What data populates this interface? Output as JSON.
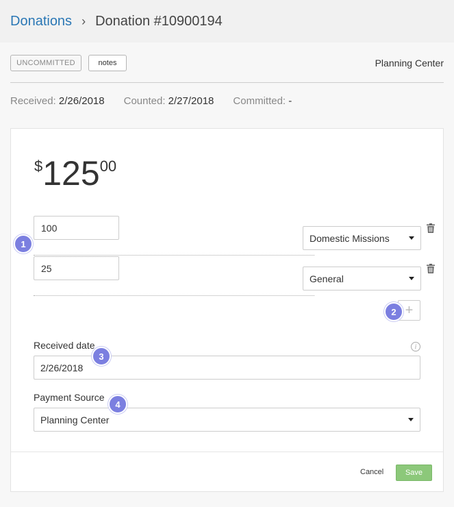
{
  "breadcrumb": {
    "parent": "Donations",
    "separator": "›",
    "current": "Donation #10900194"
  },
  "status": {
    "badge": "UNCOMMITTED",
    "notes_label": "notes",
    "source": "Planning Center"
  },
  "dates": {
    "received_label": "Received:",
    "received_value": "2/26/2018",
    "counted_label": "Counted:",
    "counted_value": "2/27/2018",
    "committed_label": "Committed:",
    "committed_value": "-"
  },
  "amount": {
    "currency": "$",
    "whole": "125",
    "cents": "00"
  },
  "designations": [
    {
      "amount": "100",
      "fund": "Domestic Missions"
    },
    {
      "amount": "25",
      "fund": "General"
    }
  ],
  "add_designation_icon": "plus-icon",
  "received_date": {
    "label": "Received date",
    "value": "2/26/2018"
  },
  "payment_source": {
    "label": "Payment Source",
    "value": "Planning Center"
  },
  "actions": {
    "cancel": "Cancel",
    "save": "Save"
  },
  "markers": [
    "1",
    "2",
    "3",
    "4"
  ],
  "colors": {
    "link": "#2a77b5",
    "save": "#8cc87a",
    "marker": "#7b7fe0"
  }
}
